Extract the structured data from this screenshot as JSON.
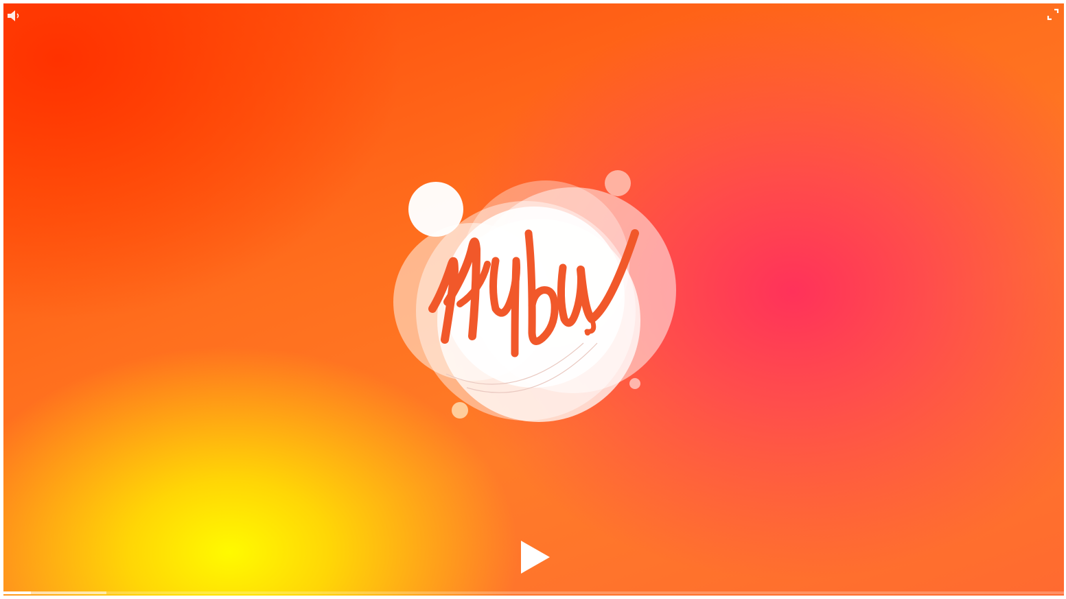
{
  "player": {
    "logo_alt": "Hubu",
    "icons": {
      "volume": "volume-icon",
      "fullscreen": "fullscreen-icon",
      "play": "play-icon"
    },
    "progress": {
      "played_fraction": 0.026,
      "buffered_fraction": 0.097
    },
    "colors": {
      "logo_script": "#f1582a",
      "controls": "#ffffff"
    }
  }
}
